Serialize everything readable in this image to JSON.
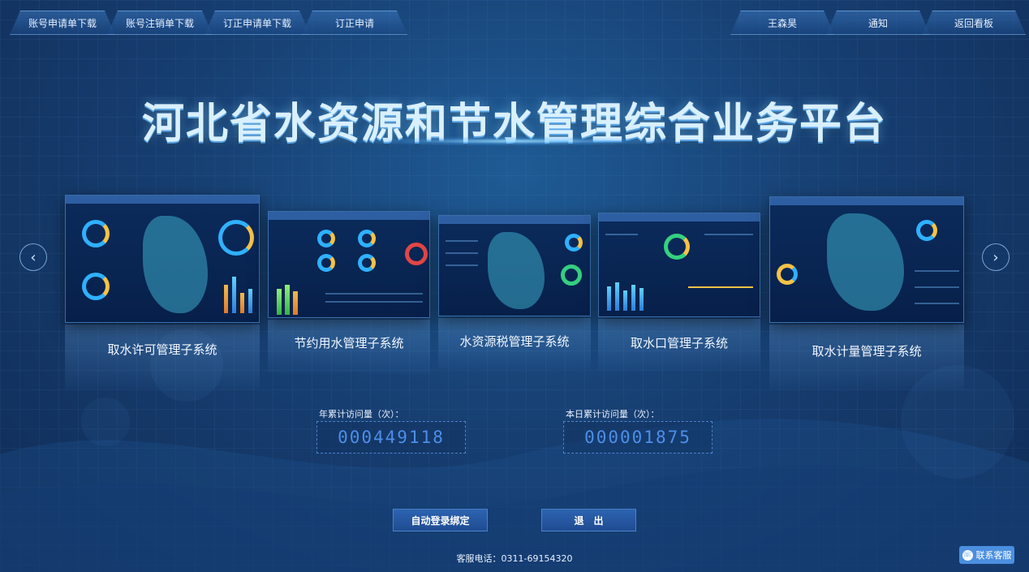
{
  "nav_left": [
    "账号申请单下载",
    "账号注销单下载",
    "订正申请单下载",
    "订正申请"
  ],
  "nav_right": [
    "王森昊",
    "通知",
    "返回看板"
  ],
  "title": "河北省水资源和节水管理综合业务平台",
  "carousel": {
    "prev_icon": "chevron-left-icon",
    "next_icon": "chevron-right-icon",
    "cards": [
      {
        "label": "取水许可管理子系统"
      },
      {
        "label": "节约用水管理子系统"
      },
      {
        "label": "水资源税管理子系统"
      },
      {
        "label": "取水口管理子系统"
      },
      {
        "label": "取水计量管理子系统"
      }
    ]
  },
  "stats": {
    "year_label": "年累计访问量（次）：",
    "year_value": "000449118",
    "day_label": "本日累计访问量（次）：",
    "day_value": "000001875"
  },
  "buttons": {
    "auto_login": "自动登录绑定",
    "logout": "退　出"
  },
  "phone": "客服电话：0311-69154320",
  "contact": {
    "label": "联系客服",
    "icon": "headset-icon"
  },
  "colors": {
    "accent": "#2d63b0",
    "counter": "#4e8ee8",
    "background": "#173f72"
  }
}
